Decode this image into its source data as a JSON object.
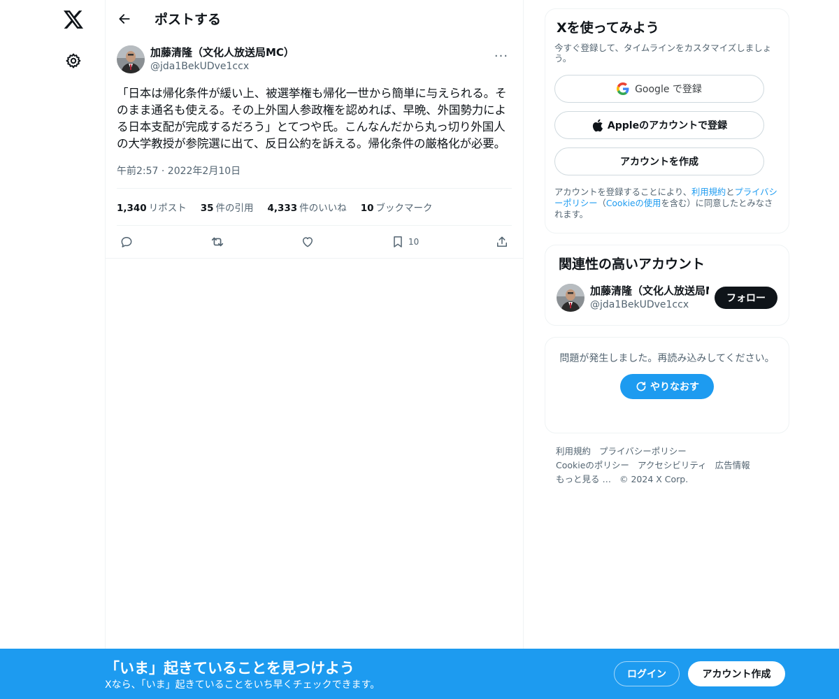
{
  "topbar": {
    "title": "ポストする"
  },
  "tweet": {
    "author_name": "加藤清隆（文化人放送局MC）",
    "author_handle": "@jda1BekUDve1ccx",
    "text": "「日本は帰化条件が緩い上、被選挙権も帰化一世から簡単に与えられる。そのまま通名も使える。その上外国人参政権を認めれば、早晩、外国勢力による日本支配が完成するだろう」とてつや氏。こんなんだから丸っ切り外国人の大学教授が参院選に出て、反日公約を訴える。帰化条件の厳格化が必要。",
    "timestamp": "午前2:57 · 2022年2月10日",
    "more_label": "···",
    "stats": [
      {
        "count": "1,340",
        "label": "リポスト"
      },
      {
        "count": "35",
        "label": "件の引用"
      },
      {
        "count": "4,333",
        "label": "件のいいね"
      },
      {
        "count": "10",
        "label": "ブックマーク"
      }
    ],
    "actions": {
      "bookmark_count": "10"
    }
  },
  "signup": {
    "title": "Xを使ってみよう",
    "subtitle": "今すぐ登録して、タイムラインをカスタマイズしましょう。",
    "google_label": "Google で登録",
    "apple_label": "Appleのアカウントで登録",
    "create_label": "アカウントを作成",
    "legal_prefix": "アカウントを登録することにより、",
    "legal_terms": "利用規約",
    "legal_and": "と",
    "legal_privacy": "プライバシーポリシー",
    "legal_open": "（",
    "legal_cookie": "Cookieの使用",
    "legal_suffix": "を含む）に同意したとみなされます。"
  },
  "related": {
    "title": "関連性の高いアカウント",
    "name": "加藤清隆（文化人放送局MC）",
    "handle": "@jda1BekUDve1ccx",
    "follow_label": "フォロー"
  },
  "error": {
    "message": "問題が発生しました。再読み込みしてください。",
    "retry_label": "やりなおす"
  },
  "footer": {
    "terms": "利用規約",
    "privacy": "プライバシーポリシー",
    "cookie": "Cookieのポリシー",
    "accessibility": "アクセシビリティ",
    "ads": "広告情報",
    "more": "もっと見る …",
    "copyright": "© 2024 X Corp."
  },
  "bottom_bar": {
    "title": "「いま」起きていることを見つけよう",
    "subtitle": "Xなら、「いま」起きていることをいち早くチェックできます。",
    "login_label": "ログイン",
    "signup_label": "アカウント作成"
  },
  "colors": {
    "accent": "#1d9bf0",
    "text": "#0f1419",
    "muted": "#536471",
    "border": "#eff3f4"
  },
  "icons": {
    "logo": "x-logo-icon",
    "settings": "gear-icon",
    "back": "arrow-left-icon",
    "reply": "reply-icon",
    "repost": "repost-icon",
    "like": "heart-icon",
    "bookmark": "bookmark-icon",
    "share": "share-icon",
    "google": "google-icon",
    "apple": "apple-icon",
    "refresh": "refresh-icon"
  }
}
